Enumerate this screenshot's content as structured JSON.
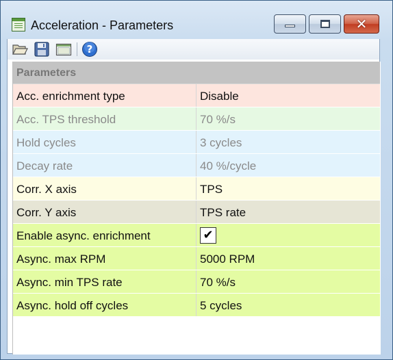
{
  "window": {
    "title": "Acceleration - Parameters",
    "buttons": {
      "minimize_icon": "minimize-icon",
      "maximize_icon": "maximize-icon",
      "close_glyph": "✕"
    }
  },
  "toolbar": {
    "icons": [
      "open-folder-icon",
      "save-icon",
      "window-icon",
      "help-icon"
    ],
    "help_glyph": "?"
  },
  "parameters": {
    "section_label": "Parameters",
    "rows": [
      {
        "name": "Acc. enrichment type",
        "value": "Disable",
        "enabled": true,
        "color": "#fde5de"
      },
      {
        "name": "Acc. TPS threshold",
        "value": "70 %/s",
        "enabled": false,
        "color": "#e6f9e3"
      },
      {
        "name": "Hold cycles",
        "value": "3 cycles",
        "enabled": false,
        "color": "#e2f3fd"
      },
      {
        "name": "Decay rate",
        "value": "40 %/cycle",
        "enabled": false,
        "color": "#e2f3fd"
      },
      {
        "name": "Corr. X axis",
        "value": "TPS",
        "enabled": true,
        "color": "#fefde3"
      },
      {
        "name": "Corr. Y axis",
        "value": "TPS rate",
        "enabled": true,
        "color": "#e6e5d5"
      },
      {
        "name": "Enable async. enrichment",
        "value": "✔",
        "checked": true,
        "enabled": true,
        "color": "#e4fca3"
      },
      {
        "name": "Async. max RPM",
        "value": "5000 RPM",
        "enabled": true,
        "color": "#e4fca3"
      },
      {
        "name": "Async. min TPS rate",
        "value": "70 %/s",
        "enabled": true,
        "color": "#e4fca3"
      },
      {
        "name": "Async. hold off cycles",
        "value": "5 cycles",
        "enabled": true,
        "color": "#e4fca3"
      }
    ]
  }
}
